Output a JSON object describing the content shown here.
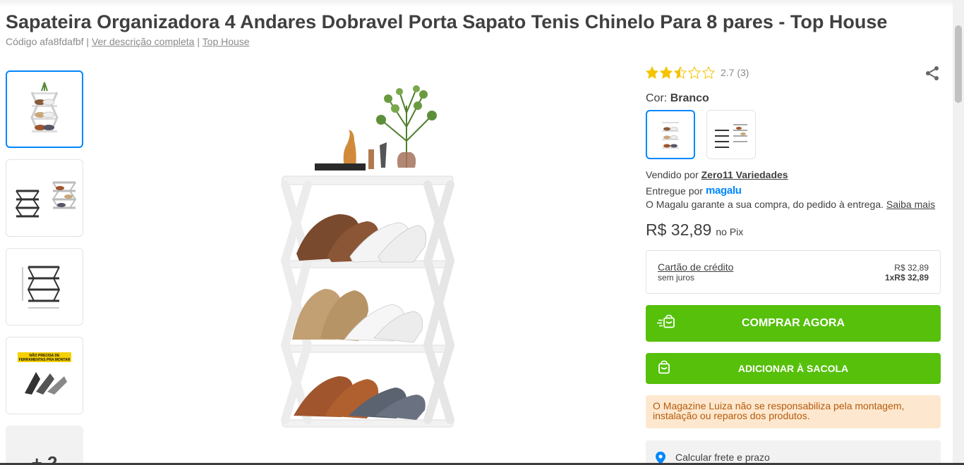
{
  "product": {
    "title": "Sapateira Organizadora 4 Andares Dobravel Porta Sapato Tenis Chinelo Para 8 pares - Top House",
    "code_label": "Código afa8fdafbf",
    "separator": "|",
    "see_description": "Ver descrição completa",
    "brand": "Top House"
  },
  "gallery": {
    "more_label": "+ 2"
  },
  "rating": {
    "value": 2.7,
    "text": "2.7 (3)"
  },
  "color": {
    "label": "Cor:",
    "selected": "Branco"
  },
  "seller": {
    "sold_by_label": "Vendido por",
    "sold_by": "Zero11 Variedades",
    "delivered_by_label": "Entregue por",
    "delivered_by": "magalu",
    "guarantee": "O Magalu garante a sua compra, do pedido à entrega.",
    "learn_more": "Saiba mais"
  },
  "price": {
    "value": "R$ 32,89",
    "method": "no Pix"
  },
  "credit": {
    "label": "Cartão de crédito",
    "sub": "sem juros",
    "total": "R$ 32,89",
    "installment": "1xR$ 32,89"
  },
  "actions": {
    "buy_now": "COMPRAR AGORA",
    "add_to_bag": "ADICIONAR À SACOLA"
  },
  "notice": "O Magazine Luiza não se responsabiliza pela montagem, instalação ou reparos dos produtos.",
  "shipping": {
    "label": "Calcular frete e prazo"
  },
  "thumb_banner": "NÃO PRECISA DE FERRAMENTAS PRA MONTAR",
  "colors": {
    "accent": "#0086ff",
    "buy_green": "#56c00b",
    "notice_bg": "#fde8cf",
    "notice_text": "#b45a0a",
    "star": "#f5c300"
  }
}
